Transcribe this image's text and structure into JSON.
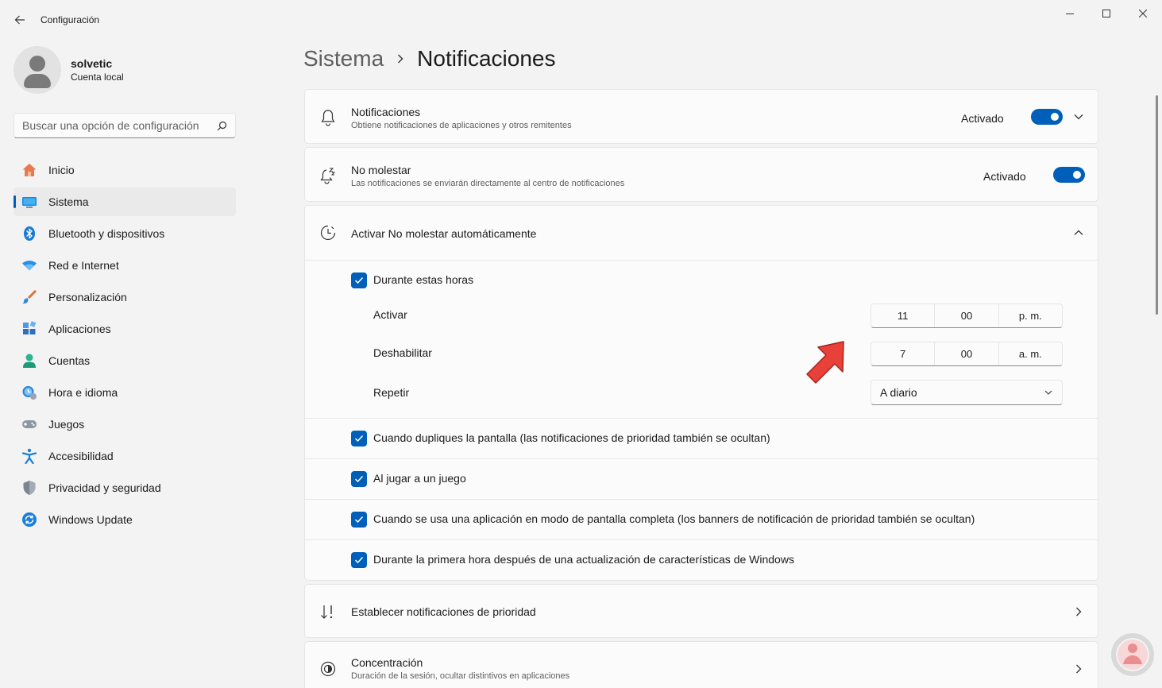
{
  "app": {
    "title": "Configuración"
  },
  "profile": {
    "name": "solvetic",
    "account": "Cuenta local"
  },
  "search": {
    "placeholder": "Buscar una opción de configuración",
    "icon": "search-icon"
  },
  "sidebar": {
    "items": [
      {
        "label": "Inicio",
        "icon": "home-icon"
      },
      {
        "label": "Sistema",
        "icon": "system-icon",
        "selected": true
      },
      {
        "label": "Bluetooth y dispositivos",
        "icon": "bluetooth-icon"
      },
      {
        "label": "Red e Internet",
        "icon": "wifi-icon"
      },
      {
        "label": "Personalización",
        "icon": "brush-icon"
      },
      {
        "label": "Aplicaciones",
        "icon": "apps-icon"
      },
      {
        "label": "Cuentas",
        "icon": "accounts-icon"
      },
      {
        "label": "Hora e idioma",
        "icon": "time-language-icon"
      },
      {
        "label": "Juegos",
        "icon": "gamepad-icon"
      },
      {
        "label": "Accesibilidad",
        "icon": "accessibility-icon"
      },
      {
        "label": "Privacidad y seguridad",
        "icon": "shield-icon"
      },
      {
        "label": "Windows Update",
        "icon": "update-icon"
      }
    ]
  },
  "breadcrumb": {
    "parent": "Sistema",
    "current": "Notificaciones"
  },
  "notifications": {
    "title": "Notificaciones",
    "subtitle": "Obtiene notificaciones de aplicaciones y otros remitentes",
    "state": "Activado",
    "on": true
  },
  "dnd": {
    "title": "No molestar",
    "subtitle": "Las notificaciones se enviarán directamente al centro de notificaciones",
    "state": "Activado",
    "on": true
  },
  "auto_dnd": {
    "title": "Activar No molestar automáticamente",
    "during_hours": {
      "label": "Durante estas horas",
      "checked": true
    },
    "activar": {
      "label": "Activar",
      "hour": "11",
      "minute": "00",
      "period": "p. m."
    },
    "deshabilitar": {
      "label": "Deshabilitar",
      "hour": "7",
      "minute": "00",
      "period": "a. m."
    },
    "repetir": {
      "label": "Repetir",
      "value": "A diario"
    },
    "options": [
      {
        "label": "Cuando dupliques la pantalla (las notificaciones de prioridad también se ocultan)",
        "checked": true
      },
      {
        "label": "Al jugar a un juego",
        "checked": true
      },
      {
        "label": "Cuando se usa una aplicación en modo de pantalla completa (los banners de notificación de prioridad también se ocultan)",
        "checked": true
      },
      {
        "label": "Durante la primera hora después de una actualización de características de Windows",
        "checked": true
      }
    ]
  },
  "priority": {
    "title": "Establecer notificaciones de prioridad"
  },
  "focus": {
    "title": "Concentración",
    "subtitle": "Duración de la sesión, ocultar distintivos en aplicaciones"
  },
  "colors": {
    "accent": "#005fb8",
    "annotation_arrow": "#e8413a"
  }
}
